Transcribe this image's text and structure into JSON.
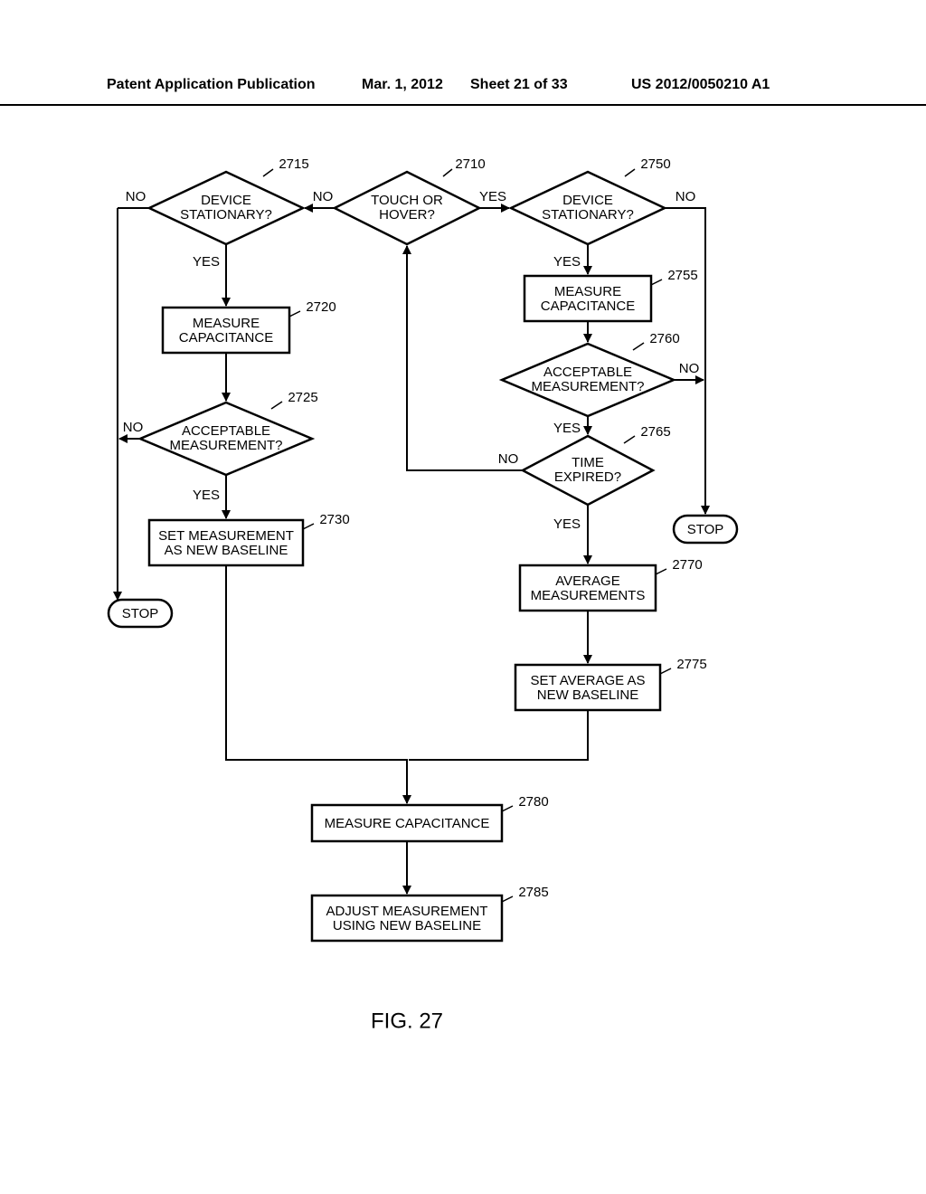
{
  "header": {
    "left": "Patent Application Publication",
    "date": "Mar. 1, 2012",
    "sheet": "Sheet 21 of 33",
    "pubno": "US 2012/0050210 A1"
  },
  "figure_label": "FIG. 27",
  "nodes": {
    "n2710": {
      "text": "TOUCH OR\nHOVER?",
      "ref": "2710"
    },
    "n2715": {
      "text": "DEVICE\nSTATIONARY?",
      "ref": "2715"
    },
    "n2720": {
      "text": "MEASURE\nCAPACITANCE",
      "ref": "2720"
    },
    "n2725": {
      "text": "ACCEPTABLE\nMEASUREMENT?",
      "ref": "2725"
    },
    "n2730": {
      "text": "SET MEASUREMENT\nAS NEW BASELINE",
      "ref": "2730"
    },
    "n2750": {
      "text": "DEVICE\nSTATIONARY?",
      "ref": "2750"
    },
    "n2755": {
      "text": "MEASURE\nCAPACITANCE",
      "ref": "2755"
    },
    "n2760": {
      "text": "ACCEPTABLE\nMEASUREMENT?",
      "ref": "2760"
    },
    "n2765": {
      "text": "TIME\nEXPIRED?",
      "ref": "2765"
    },
    "n2770": {
      "text": "AVERAGE\nMEASUREMENTS",
      "ref": "2770"
    },
    "n2775": {
      "text": "SET AVERAGE AS\nNEW BASELINE",
      "ref": "2775"
    },
    "n2780": {
      "text": "MEASURE CAPACITANCE",
      "ref": "2780"
    },
    "n2785": {
      "text": "ADJUST MEASUREMENT\nUSING NEW BASELINE",
      "ref": "2785"
    },
    "stop1": {
      "text": "STOP"
    },
    "stop2": {
      "text": "STOP"
    }
  },
  "branches": {
    "yes": "YES",
    "no": "NO"
  }
}
